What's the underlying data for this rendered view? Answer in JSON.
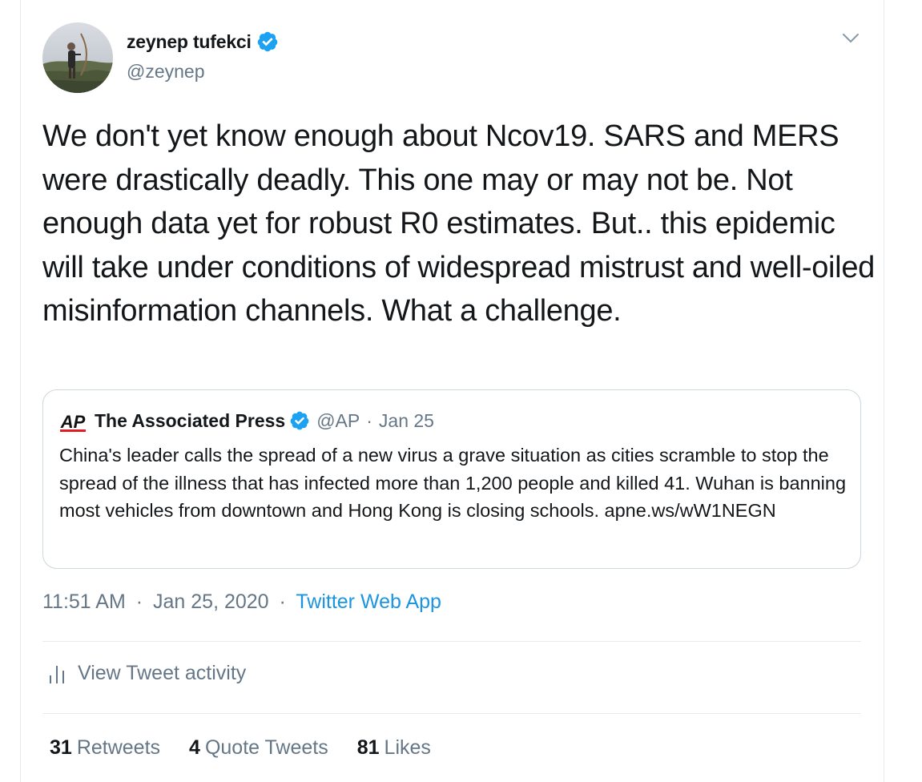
{
  "colors": {
    "verified": "#1da1f2",
    "link": "#1b95e0",
    "secondary_text": "#657786",
    "border": "#e6ecf0"
  },
  "tweet": {
    "author": {
      "display_name": "zeynep tufekci",
      "handle": "@zeynep",
      "verified": true
    },
    "menu_icon": "chevron-down-icon",
    "text": "We don't yet know enough about Ncov19. SARS and MERS were drastically deadly. This one may or may not be. Not enough data yet for robust R0 estimates. But.. this epidemic will take under conditions of widespread mistrust and well-oiled misinformation channels. What a challenge.",
    "quoted": {
      "logo_text": "AP",
      "display_name": "The Associated Press",
      "verified": true,
      "handle": "@AP",
      "dot": "·",
      "date": "Jan 25",
      "text": "China's leader calls the spread of a new virus a grave situation as cities scramble to stop the spread of the illness that has infected more than 1,200 people and killed 41. Wuhan is banning most vehicles from downtown and Hong Kong is closing schools. apne.ws/wW1NEGN"
    },
    "meta": {
      "time": "11:51 AM",
      "date": "Jan 25, 2020",
      "separator": "·",
      "source": "Twitter Web App"
    },
    "activity": {
      "icon": "bar-chart-icon",
      "label": "View Tweet activity"
    },
    "stats": {
      "retweets": {
        "count": "31",
        "label": "Retweets"
      },
      "quote_tweets": {
        "count": "4",
        "label": "Quote Tweets"
      },
      "likes": {
        "count": "81",
        "label": "Likes"
      }
    }
  }
}
